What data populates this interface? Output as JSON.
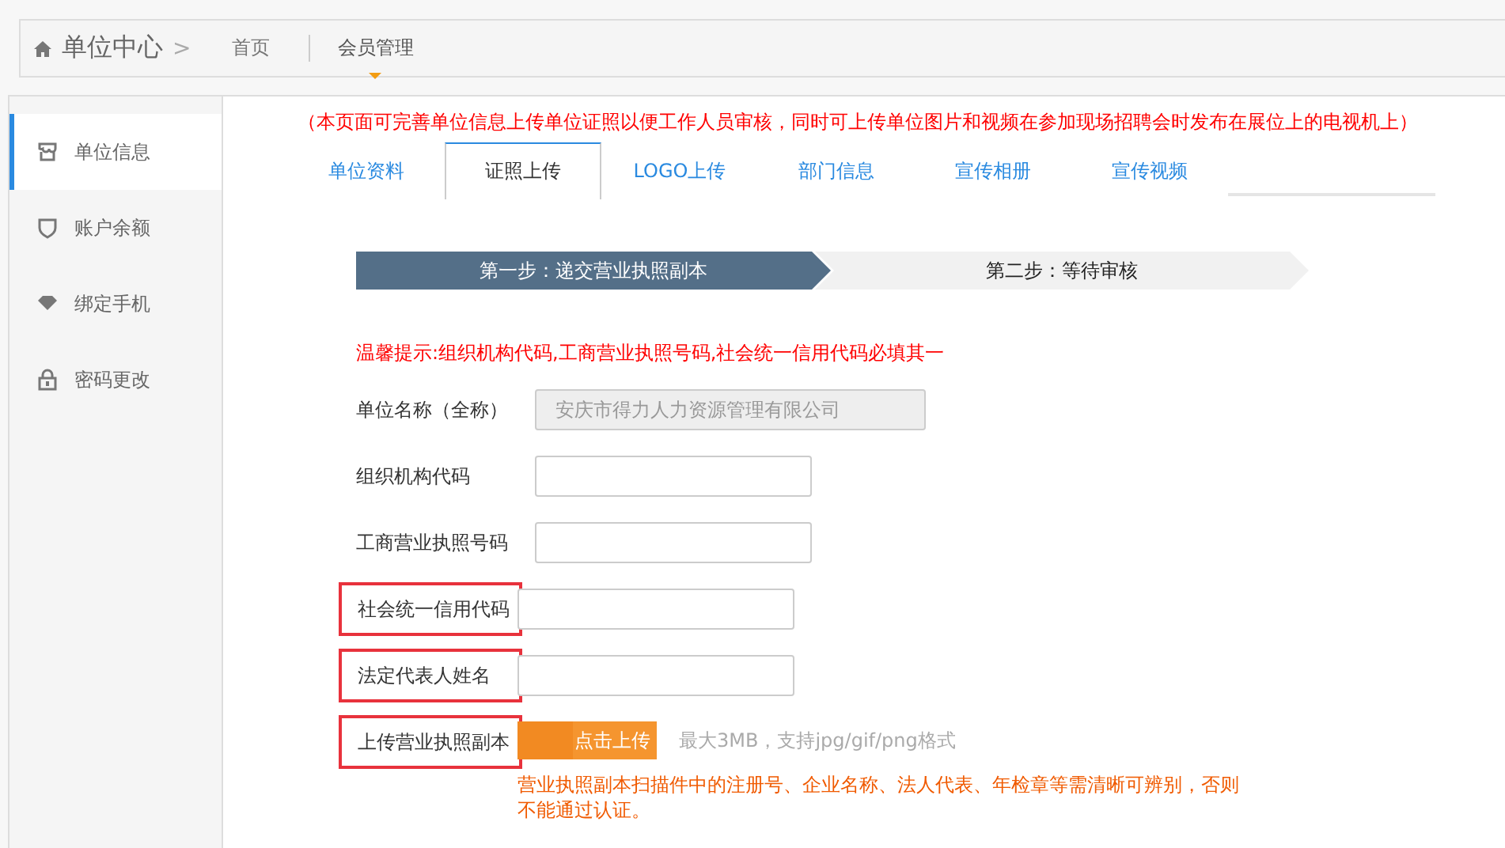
{
  "header": {
    "title": "单位中心",
    "separator": ">",
    "links": [
      {
        "label": "首页",
        "selected": false
      },
      {
        "label": "会员管理",
        "selected": true
      }
    ]
  },
  "sidebar": {
    "items": [
      {
        "label": "单位信息",
        "selected": true
      },
      {
        "label": "账户余额",
        "selected": false
      },
      {
        "label": "绑定手机",
        "selected": false
      },
      {
        "label": "密码更改",
        "selected": false
      }
    ]
  },
  "notice": "（本页面可完善单位信息上传单位证照以便工作人员审核，同时可上传单位图片和视频在参加现场招聘会时发布在展位上的电视机上）",
  "tabs": [
    {
      "label": "单位资料",
      "selected": false
    },
    {
      "label": "证照上传",
      "selected": true
    },
    {
      "label": "LOGO上传",
      "selected": false
    },
    {
      "label": "部门信息",
      "selected": false
    },
    {
      "label": "宣传相册",
      "selected": false
    },
    {
      "label": "宣传视频",
      "selected": false
    }
  ],
  "steps": [
    {
      "label": "第一步：递交营业执照副本",
      "selected": true
    },
    {
      "label": "第二步：等待审核",
      "selected": false
    }
  ],
  "tip": "温馨提示:组织机构代码,工商营业执照号码,社会统一信用代码必填其一",
  "form": [
    {
      "kind": "input",
      "label": "单位名称（全称）",
      "value": "安庆市得力人力资源管理有限公司",
      "disabled": true,
      "highlighted": false
    },
    {
      "kind": "input",
      "label": "组织机构代码",
      "disabled": false,
      "highlighted": false
    },
    {
      "kind": "input",
      "label": "工商营业执照号码",
      "disabled": false,
      "highlighted": false
    },
    {
      "kind": "input",
      "label": "社会统一信用代码",
      "disabled": false,
      "highlighted": true
    },
    {
      "kind": "input",
      "label": "法定代表人姓名",
      "disabled": false,
      "highlighted": true
    },
    {
      "kind": "upload",
      "label": "上传营业执照副本",
      "button": "点击上传",
      "hint": "最大3MB，支持jpg/gif/png格式",
      "note": "营业执照副本扫描件中的注册号、企业名称、法人代表、年检章等需清晰可辨别，否则不能通过认证。",
      "highlighted": true
    }
  ]
}
